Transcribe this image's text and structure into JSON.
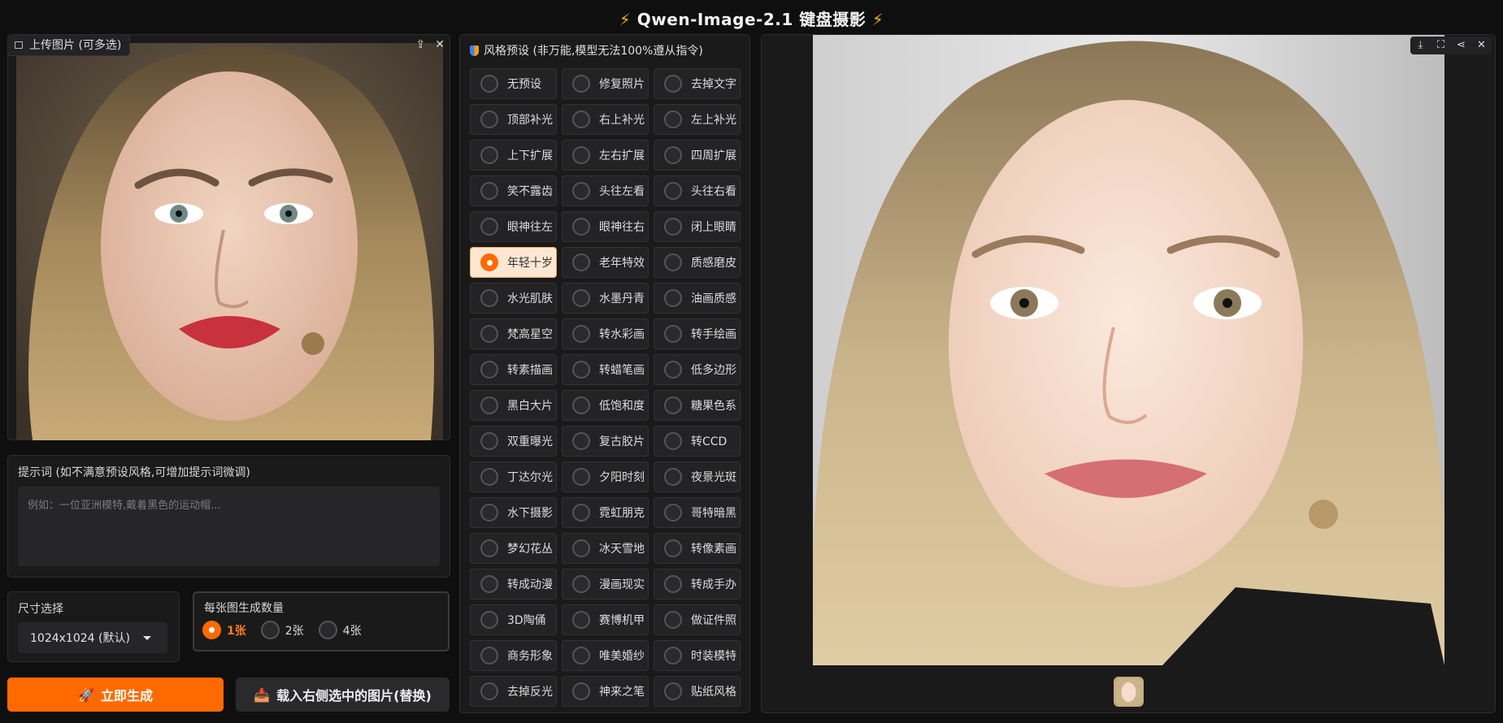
{
  "title": "Qwen-Image-2.1 键盘摄影",
  "title_icon": "⚡",
  "upload": {
    "label": "上传图片 (可多选)",
    "tools": [
      "upload-icon",
      "close-icon"
    ]
  },
  "prompt": {
    "label": "提示词 (如不满意预设风格,可增加提示词微调)",
    "placeholder": "例如：一位亚洲模特,戴着黑色的运动帽..."
  },
  "size": {
    "label": "尺寸选择",
    "value": "1024x1024 (默认)"
  },
  "count": {
    "label": "每张图生成数量",
    "options": [
      "1张",
      "2张",
      "4张"
    ],
    "selected": "1张"
  },
  "buttons": {
    "generate": "立即生成",
    "load": "载入右侧选中的图片(替换)"
  },
  "presets": {
    "title": "风格预设 (非万能,模型无法100%遵从指令)",
    "selected": "年轻十岁",
    "items": [
      "无预设",
      "修复照片",
      "去掉文字",
      "顶部补光",
      "右上补光",
      "左上补光",
      "上下扩展",
      "左右扩展",
      "四周扩展",
      "笑不露齿",
      "头往左看",
      "头往右看",
      "眼神往左",
      "眼神往右",
      "闭上眼睛",
      "年轻十岁",
      "老年特效",
      "质感磨皮",
      "水光肌肤",
      "水墨丹青",
      "油画质感",
      "梵高星空",
      "转水彩画",
      "转手绘画",
      "转素描画",
      "转蜡笔画",
      "低多边形",
      "黑白大片",
      "低饱和度",
      "糖果色系",
      "双重曝光",
      "复古胶片",
      "转CCD",
      "丁达尔光",
      "夕阳时刻",
      "夜景光斑",
      "水下摄影",
      "霓虹朋克",
      "哥特暗黑",
      "梦幻花丛",
      "冰天雪地",
      "转像素画",
      "转成动漫",
      "漫画现实",
      "转成手办",
      "3D陶俑",
      "赛博机甲",
      "做证件照",
      "商务形象",
      "唯美婚纱",
      "时装模特",
      "去掉反光",
      "神来之笔",
      "贴纸风格"
    ]
  },
  "result": {
    "tools": [
      "download-icon",
      "fullscreen-icon",
      "share-icon",
      "close-icon"
    ]
  },
  "colors": {
    "accent": "#ff6a00",
    "panel": "#1a1a1b",
    "background": "#0f0f10"
  }
}
